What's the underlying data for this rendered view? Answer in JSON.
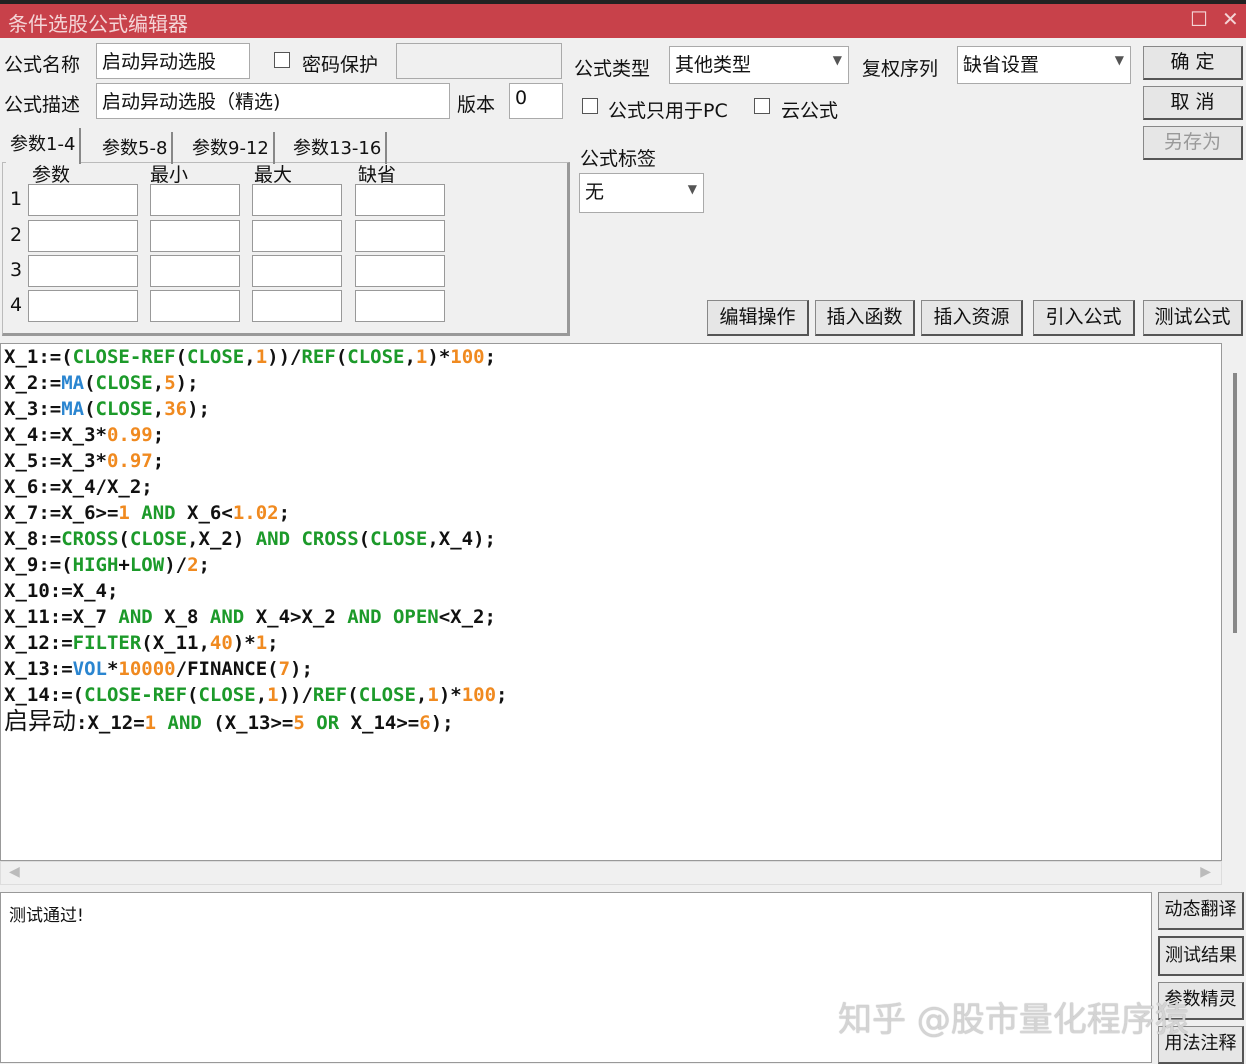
{
  "window": {
    "title": "条件选股公式编辑器",
    "restore": "☐",
    "close": "✕"
  },
  "form": {
    "name_label": "公式名称",
    "name_value": "启动异动选股",
    "password_label": "密码保护",
    "password_value": "",
    "desc_label": "公式描述",
    "desc_value": "启动异动选股（精选)",
    "version_label": "版本",
    "version_value": "0",
    "type_label": "公式类型",
    "type_value": "其他类型",
    "fuquan_label": "复权序列",
    "fuquan_value": "缺省设置",
    "pc_only_label": "公式只用于PC",
    "cloud_label": "云公式",
    "tag_label": "公式标签",
    "tag_value": "无"
  },
  "buttons": {
    "ok": "确  定",
    "cancel": "取  消",
    "save_as": "另存为",
    "edit_ops": "编辑操作",
    "insert_func": "插入函数",
    "insert_res": "插入资源",
    "import": "引入公式",
    "test": "测试公式",
    "translate": "动态翻译",
    "test_result": "测试结果",
    "param_wizard": "参数精灵",
    "usage": "用法注释"
  },
  "params": {
    "tabs": [
      "参数1-4",
      "参数5-8",
      "参数9-12",
      "参数13-16"
    ],
    "headers": [
      "参数",
      "最小",
      "最大",
      "缺省"
    ],
    "rows": [
      "1",
      "2",
      "3",
      "4"
    ]
  },
  "code": [
    [
      [
        "X_1:=(",
        "p"
      ],
      [
        "CLOSE-REF",
        "k"
      ],
      [
        "(",
        "p"
      ],
      [
        "CLOSE",
        "k"
      ],
      [
        ",",
        "p"
      ],
      [
        "1",
        "n"
      ],
      [
        "))/",
        "p"
      ],
      [
        "REF",
        "k"
      ],
      [
        "(",
        "p"
      ],
      [
        "CLOSE",
        "k"
      ],
      [
        ",",
        "p"
      ],
      [
        "1",
        "n"
      ],
      [
        ")*",
        "p"
      ],
      [
        "100",
        "n"
      ],
      [
        ";",
        "p"
      ]
    ],
    [
      [
        "X_2:=",
        "p"
      ],
      [
        "MA",
        "f"
      ],
      [
        "(",
        "p"
      ],
      [
        "CLOSE",
        "k"
      ],
      [
        ",",
        "p"
      ],
      [
        "5",
        "n"
      ],
      [
        ");",
        "p"
      ]
    ],
    [
      [
        "X_3:=",
        "p"
      ],
      [
        "MA",
        "f"
      ],
      [
        "(",
        "p"
      ],
      [
        "CLOSE",
        "k"
      ],
      [
        ",",
        "p"
      ],
      [
        "36",
        "n"
      ],
      [
        ");",
        "p"
      ]
    ],
    [
      [
        "X_4:=X_3*",
        "p"
      ],
      [
        "0.99",
        "n"
      ],
      [
        ";",
        "p"
      ]
    ],
    [
      [
        "X_5:=X_3*",
        "p"
      ],
      [
        "0.97",
        "n"
      ],
      [
        ";",
        "p"
      ]
    ],
    [
      [
        "X_6:=X_4/X_2;",
        "p"
      ]
    ],
    [
      [
        "X_7:=X_6>=",
        "p"
      ],
      [
        "1",
        "n"
      ],
      [
        " AND ",
        "k"
      ],
      [
        "X_6<",
        "p"
      ],
      [
        "1.02",
        "n"
      ],
      [
        ";",
        "p"
      ]
    ],
    [
      [
        "X_8:=",
        "p"
      ],
      [
        "CROSS",
        "k"
      ],
      [
        "(",
        "p"
      ],
      [
        "CLOSE",
        "k"
      ],
      [
        ",X_2) ",
        "p"
      ],
      [
        "AND CROSS",
        "k"
      ],
      [
        "(",
        "p"
      ],
      [
        "CLOSE",
        "k"
      ],
      [
        ",X_4);",
        "p"
      ]
    ],
    [
      [
        "X_9:=(",
        "p"
      ],
      [
        "HIGH",
        "k"
      ],
      [
        "+",
        "p"
      ],
      [
        "LOW",
        "k"
      ],
      [
        ")/",
        "p"
      ],
      [
        "2",
        "n"
      ],
      [
        ";",
        "p"
      ]
    ],
    [
      [
        "X_10:=X_4;",
        "p"
      ]
    ],
    [
      [
        "X_11:=X_7 ",
        "p"
      ],
      [
        "AND",
        "k"
      ],
      [
        " X_8 ",
        "p"
      ],
      [
        "AND",
        "k"
      ],
      [
        " X_4>X_2 ",
        "p"
      ],
      [
        "AND OPEN",
        "k"
      ],
      [
        "<X_2;",
        "p"
      ]
    ],
    [
      [
        "X_12:=",
        "p"
      ],
      [
        "FILTER",
        "k"
      ],
      [
        "(X_11,",
        "p"
      ],
      [
        "40",
        "n"
      ],
      [
        ")*",
        "p"
      ],
      [
        "1",
        "n"
      ],
      [
        ";",
        "p"
      ]
    ],
    [
      [
        "X_13:=",
        "p"
      ],
      [
        "VOL",
        "f"
      ],
      [
        "*",
        "p"
      ],
      [
        "10000",
        "n"
      ],
      [
        "/FINANCE(",
        "p"
      ],
      [
        "7",
        "n"
      ],
      [
        ");",
        "p"
      ]
    ],
    [
      [
        "X_14:=(",
        "p"
      ],
      [
        "CLOSE-REF",
        "k"
      ],
      [
        "(",
        "p"
      ],
      [
        "CLOSE",
        "k"
      ],
      [
        ",",
        "p"
      ],
      [
        "1",
        "n"
      ],
      [
        "))/",
        "p"
      ],
      [
        "REF",
        "k"
      ],
      [
        "(",
        "p"
      ],
      [
        "CLOSE",
        "k"
      ],
      [
        ",",
        "p"
      ],
      [
        "1",
        "n"
      ],
      [
        ")*",
        "p"
      ],
      [
        "100",
        "n"
      ],
      [
        ";",
        "p"
      ]
    ],
    [
      [
        "启异动",
        "c"
      ],
      [
        ":X_12=",
        "p"
      ],
      [
        "1",
        "n"
      ],
      [
        " AND ",
        "k"
      ],
      [
        "(X_13>=",
        "p"
      ],
      [
        "5",
        "n"
      ],
      [
        " OR ",
        "k"
      ],
      [
        "X_14>=",
        "p"
      ],
      [
        "6",
        "n"
      ],
      [
        ");",
        "p"
      ]
    ]
  ],
  "output": {
    "text": "测试通过!"
  },
  "watermark": "知乎 @股市量化程序猿"
}
